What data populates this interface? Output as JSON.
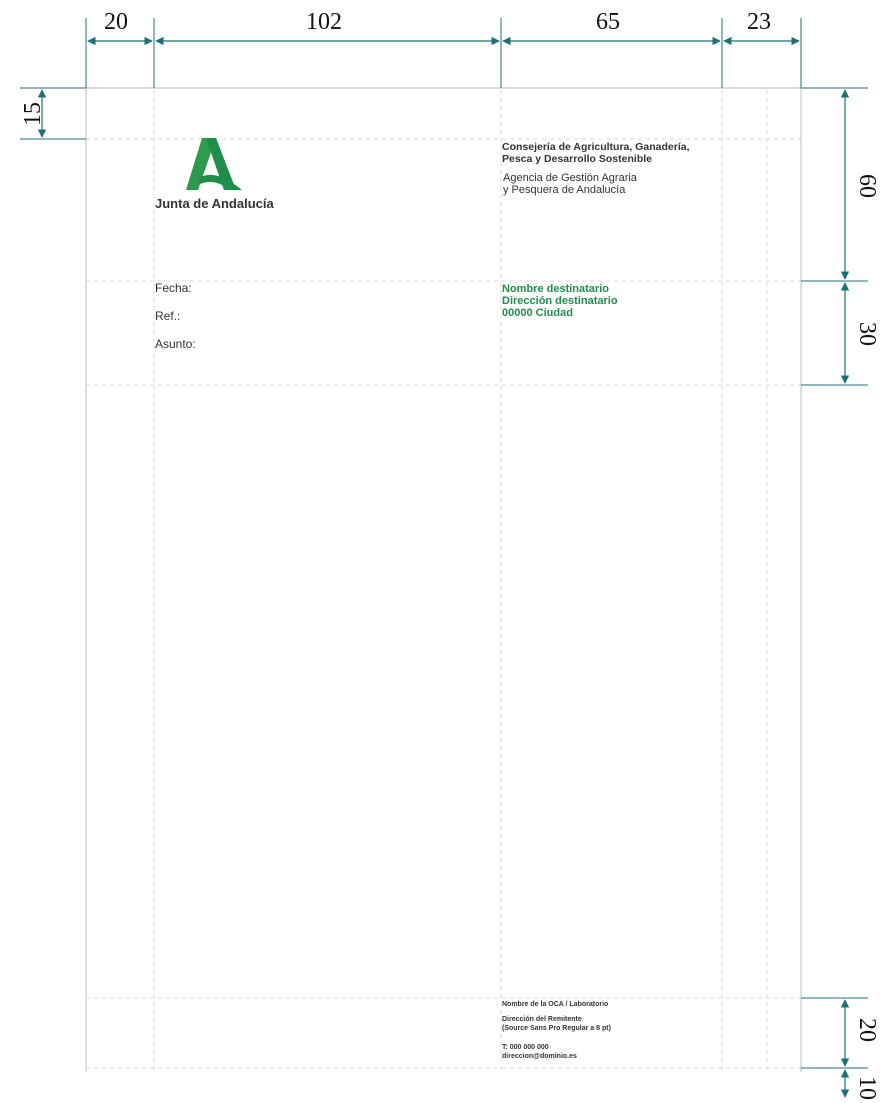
{
  "dimensions": {
    "top": [
      "20",
      "102",
      "65",
      "23"
    ],
    "left_margin": "15",
    "right": [
      "60",
      "30",
      "20",
      "10"
    ]
  },
  "logo": {
    "icon": "junta-andalucia-a-icon",
    "text": "Junta de Andalucía"
  },
  "header": {
    "department_line1": "Consejería de Agricultura, Ganadería,",
    "department_line2": "Pesca y Desarrollo Sostenible",
    "agency_line1": "Agencia de Gestión Agraria",
    "agency_line2": "y Pesquera de Andalucía"
  },
  "fields": {
    "date": "Fecha:",
    "ref": "Ref.:",
    "subject": "Asunto:"
  },
  "recipient": {
    "name": "Nombre destinatario",
    "address": "Dirección destinatario",
    "city": "00000 Ciudad"
  },
  "footer": {
    "org": "Nombre de la OCA / Laboratorio",
    "sender_address": "Dirección del Remitente",
    "font_note": "(Source Sans Pro Regular a 8 pt)",
    "phone": "T: 000 000 000",
    "email": "direccion@dominio.es"
  },
  "colors": {
    "accent": "#1f8e4a",
    "dimension": "#1f6f78",
    "guide": "#d0d0d0",
    "page_edge": "#c8c8c8"
  }
}
